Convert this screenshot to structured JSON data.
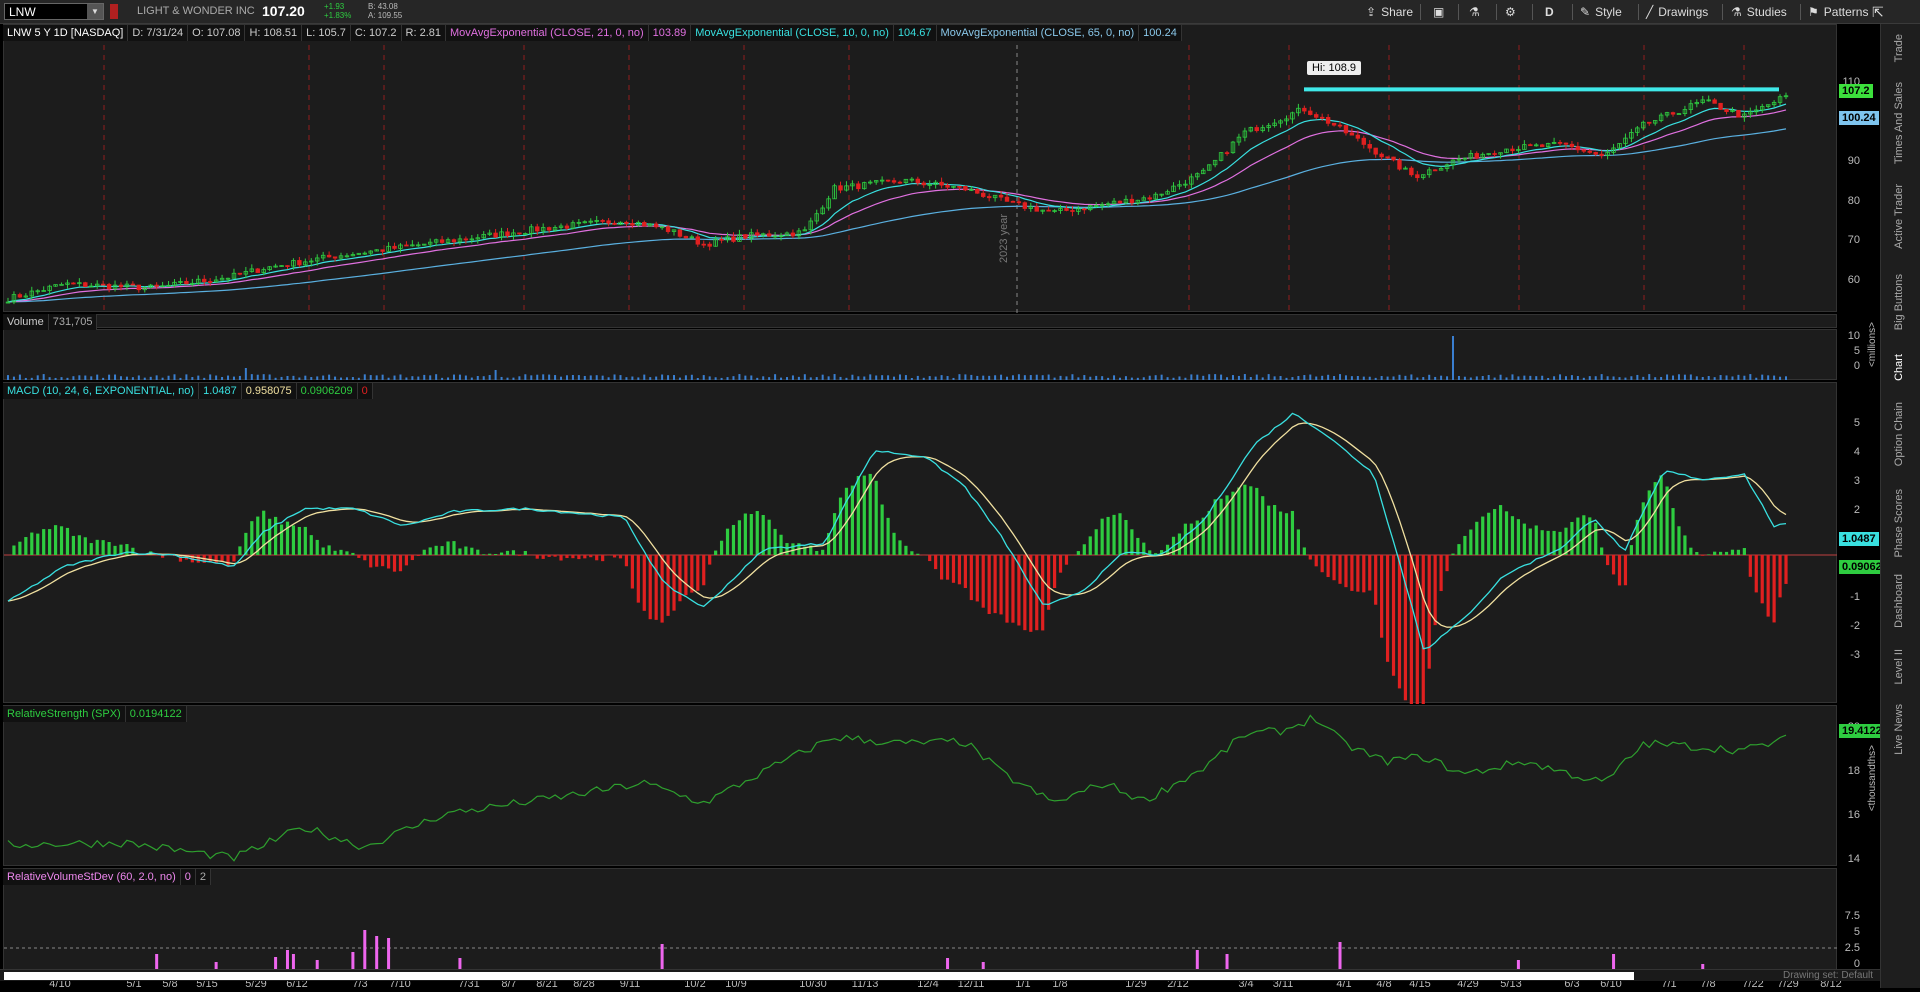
{
  "topbar": {
    "symbol": "LNW",
    "company": "LIGHT & WONDER INC",
    "price": "107.20",
    "change_abs": "+1.93",
    "change_pct": "+1.83%",
    "bid": "B: 43.08",
    "ask": "A: 109.55",
    "share_label": "Share",
    "period_label": "D",
    "style_label": "Style",
    "drawings_label": "Drawings",
    "studies_label": "Studies",
    "patterns_label": "Patterns"
  },
  "price_pane": {
    "header": [
      "LNW 5 Y 1D [NASDAQ]",
      "D: 7/31/24",
      "O: 107.08",
      "H: 108.51",
      "L: 105.7",
      "C: 107.2",
      "R: 2.81"
    ],
    "ma21_label": "MovAvgExponential (CLOSE, 21, 0, no)",
    "ma21_value": "103.89",
    "ma10_label": "MovAvgExponential (CLOSE, 10, 0, no)",
    "ma10_value": "104.67",
    "ma65_label": "MovAvgExponential (CLOSE, 65, 0, no)",
    "ma65_value": "100.24",
    "hi_label": "Hi: 108.9",
    "year_marker": "2023 year",
    "yticks": [
      "110",
      "100",
      "90",
      "80",
      "70",
      "60"
    ],
    "last_badge": "107.2",
    "ma_badge": "100.24"
  },
  "volume_pane": {
    "label": "Volume",
    "value": "731,705",
    "yticks": [
      "10",
      "5",
      "0"
    ],
    "unit": "<millions>"
  },
  "macd_pane": {
    "label": "MACD (10, 24, 6, EXPONENTIAL, no)",
    "v1": "1.0487",
    "v2": "0.958075",
    "v3": "0.0906209",
    "v4": "0",
    "yticks": [
      "5",
      "4",
      "3",
      "2",
      "1",
      "0",
      "-1",
      "-2",
      "-3"
    ],
    "badge1": "1.0487",
    "badge2": "0.09062"
  },
  "rs_pane": {
    "label": "RelativeStrength (SPX)",
    "value": "0.0194122",
    "yticks": [
      "20",
      "18",
      "16",
      "14"
    ],
    "unit": "<thousandths>",
    "badge": "19.4122"
  },
  "rv_pane": {
    "label": "RelativeVolumeStDev (60, 2.0, no)",
    "v1": "0",
    "v2": "2",
    "yticks": [
      "7.5",
      "5",
      "2.5",
      "0"
    ]
  },
  "xaxis": [
    "4/10",
    "5/1",
    "5/8",
    "5/15",
    "5/29",
    "6/12",
    "7/3",
    "7/10",
    "7/31",
    "8/7",
    "8/21",
    "8/28",
    "9/11",
    "10/2",
    "10/9",
    "10/30",
    "11/13",
    "12/4",
    "12/11",
    "1/1",
    "1/8",
    "1/29",
    "2/12",
    "3/4",
    "3/11",
    "4/1",
    "4/8",
    "4/15",
    "4/29",
    "5/13",
    "6/3",
    "6/10",
    "7/1",
    "7/8",
    "7/22",
    "7/29",
    "8/12"
  ],
  "hscroll": {
    "drawing_set": "Drawing set: Default"
  },
  "sidebar": [
    "Trade",
    "Times And Sales",
    "Active Trader",
    "Big Buttons",
    "Chart",
    "Option Chain",
    "Phase Scores",
    "Dashboard",
    "Level II",
    "Live News"
  ],
  "colors": {
    "up": "#2ecc40",
    "down": "#e02020",
    "ma10": "#39e0e0",
    "ma21": "#e070e0",
    "ma65": "#5ab0e0",
    "macd": "#39e0e0",
    "signal": "#f0e0a0",
    "rs": "#2ea02e",
    "rv": "#ee66ee"
  }
}
